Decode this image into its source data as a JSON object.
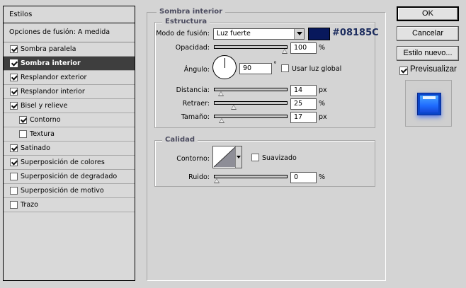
{
  "styles_panel": {
    "header": "Estilos",
    "blend_options": "Opciones de fusión: A medida",
    "items": [
      {
        "label": "Sombra paralela",
        "checked": true,
        "indent": false,
        "selected": false
      },
      {
        "label": "Sombra interior",
        "checked": true,
        "indent": false,
        "selected": true
      },
      {
        "label": "Resplandor exterior",
        "checked": true,
        "indent": false,
        "selected": false
      },
      {
        "label": "Resplandor interior",
        "checked": true,
        "indent": false,
        "selected": false
      },
      {
        "label": "Bisel y relieve",
        "checked": true,
        "indent": false,
        "selected": false
      },
      {
        "label": "Contorno",
        "checked": true,
        "indent": true,
        "selected": false
      },
      {
        "label": "Textura",
        "checked": false,
        "indent": true,
        "selected": false
      },
      {
        "label": "Satinado",
        "checked": true,
        "indent": false,
        "selected": false
      },
      {
        "label": "Superposición de colores",
        "checked": true,
        "indent": false,
        "selected": false
      },
      {
        "label": "Superposición de degradado",
        "checked": false,
        "indent": false,
        "selected": false
      },
      {
        "label": "Superposición de motivo",
        "checked": false,
        "indent": false,
        "selected": false
      },
      {
        "label": "Trazo",
        "checked": false,
        "indent": false,
        "selected": false
      }
    ]
  },
  "section": {
    "title": "Sombra interior",
    "structure": {
      "title": "Estructura",
      "blend_mode_label": "Modo de fusión:",
      "blend_mode_value": "Luz fuerte",
      "color_hex": "#08185C",
      "opacity_label": "Opacidad:",
      "opacity_value": "100",
      "opacity_fraction": 1.0,
      "percent_unit": "%",
      "angle_label": "Ángulo:",
      "angle_value": "90",
      "degree_unit": "°",
      "global_light_label": "Usar luz global",
      "global_light_checked": false,
      "distance_label": "Distancia:",
      "distance_value": "14",
      "distance_fraction": 0.06,
      "choke_label": "Retraer:",
      "choke_value": "25",
      "choke_fraction": 0.25,
      "size_label": "Tamaño:",
      "size_value": "17",
      "size_fraction": 0.07,
      "px_unit": "px"
    },
    "quality": {
      "title": "Calidad",
      "contour_label": "Contorno:",
      "antialias_label": "Suavizado",
      "antialias_checked": false,
      "noise_label": "Ruido:",
      "noise_value": "0",
      "noise_fraction": 0.0
    }
  },
  "buttons": {
    "ok": "OK",
    "cancel": "Cancelar",
    "new_style": "Estilo nuevo...",
    "preview_label": "Previsualizar",
    "preview_checked": true
  },
  "colors": {
    "shadow_color": "#08185C",
    "selected_row": "#3E3E3E",
    "preview_blue": "#1F6BFF"
  }
}
